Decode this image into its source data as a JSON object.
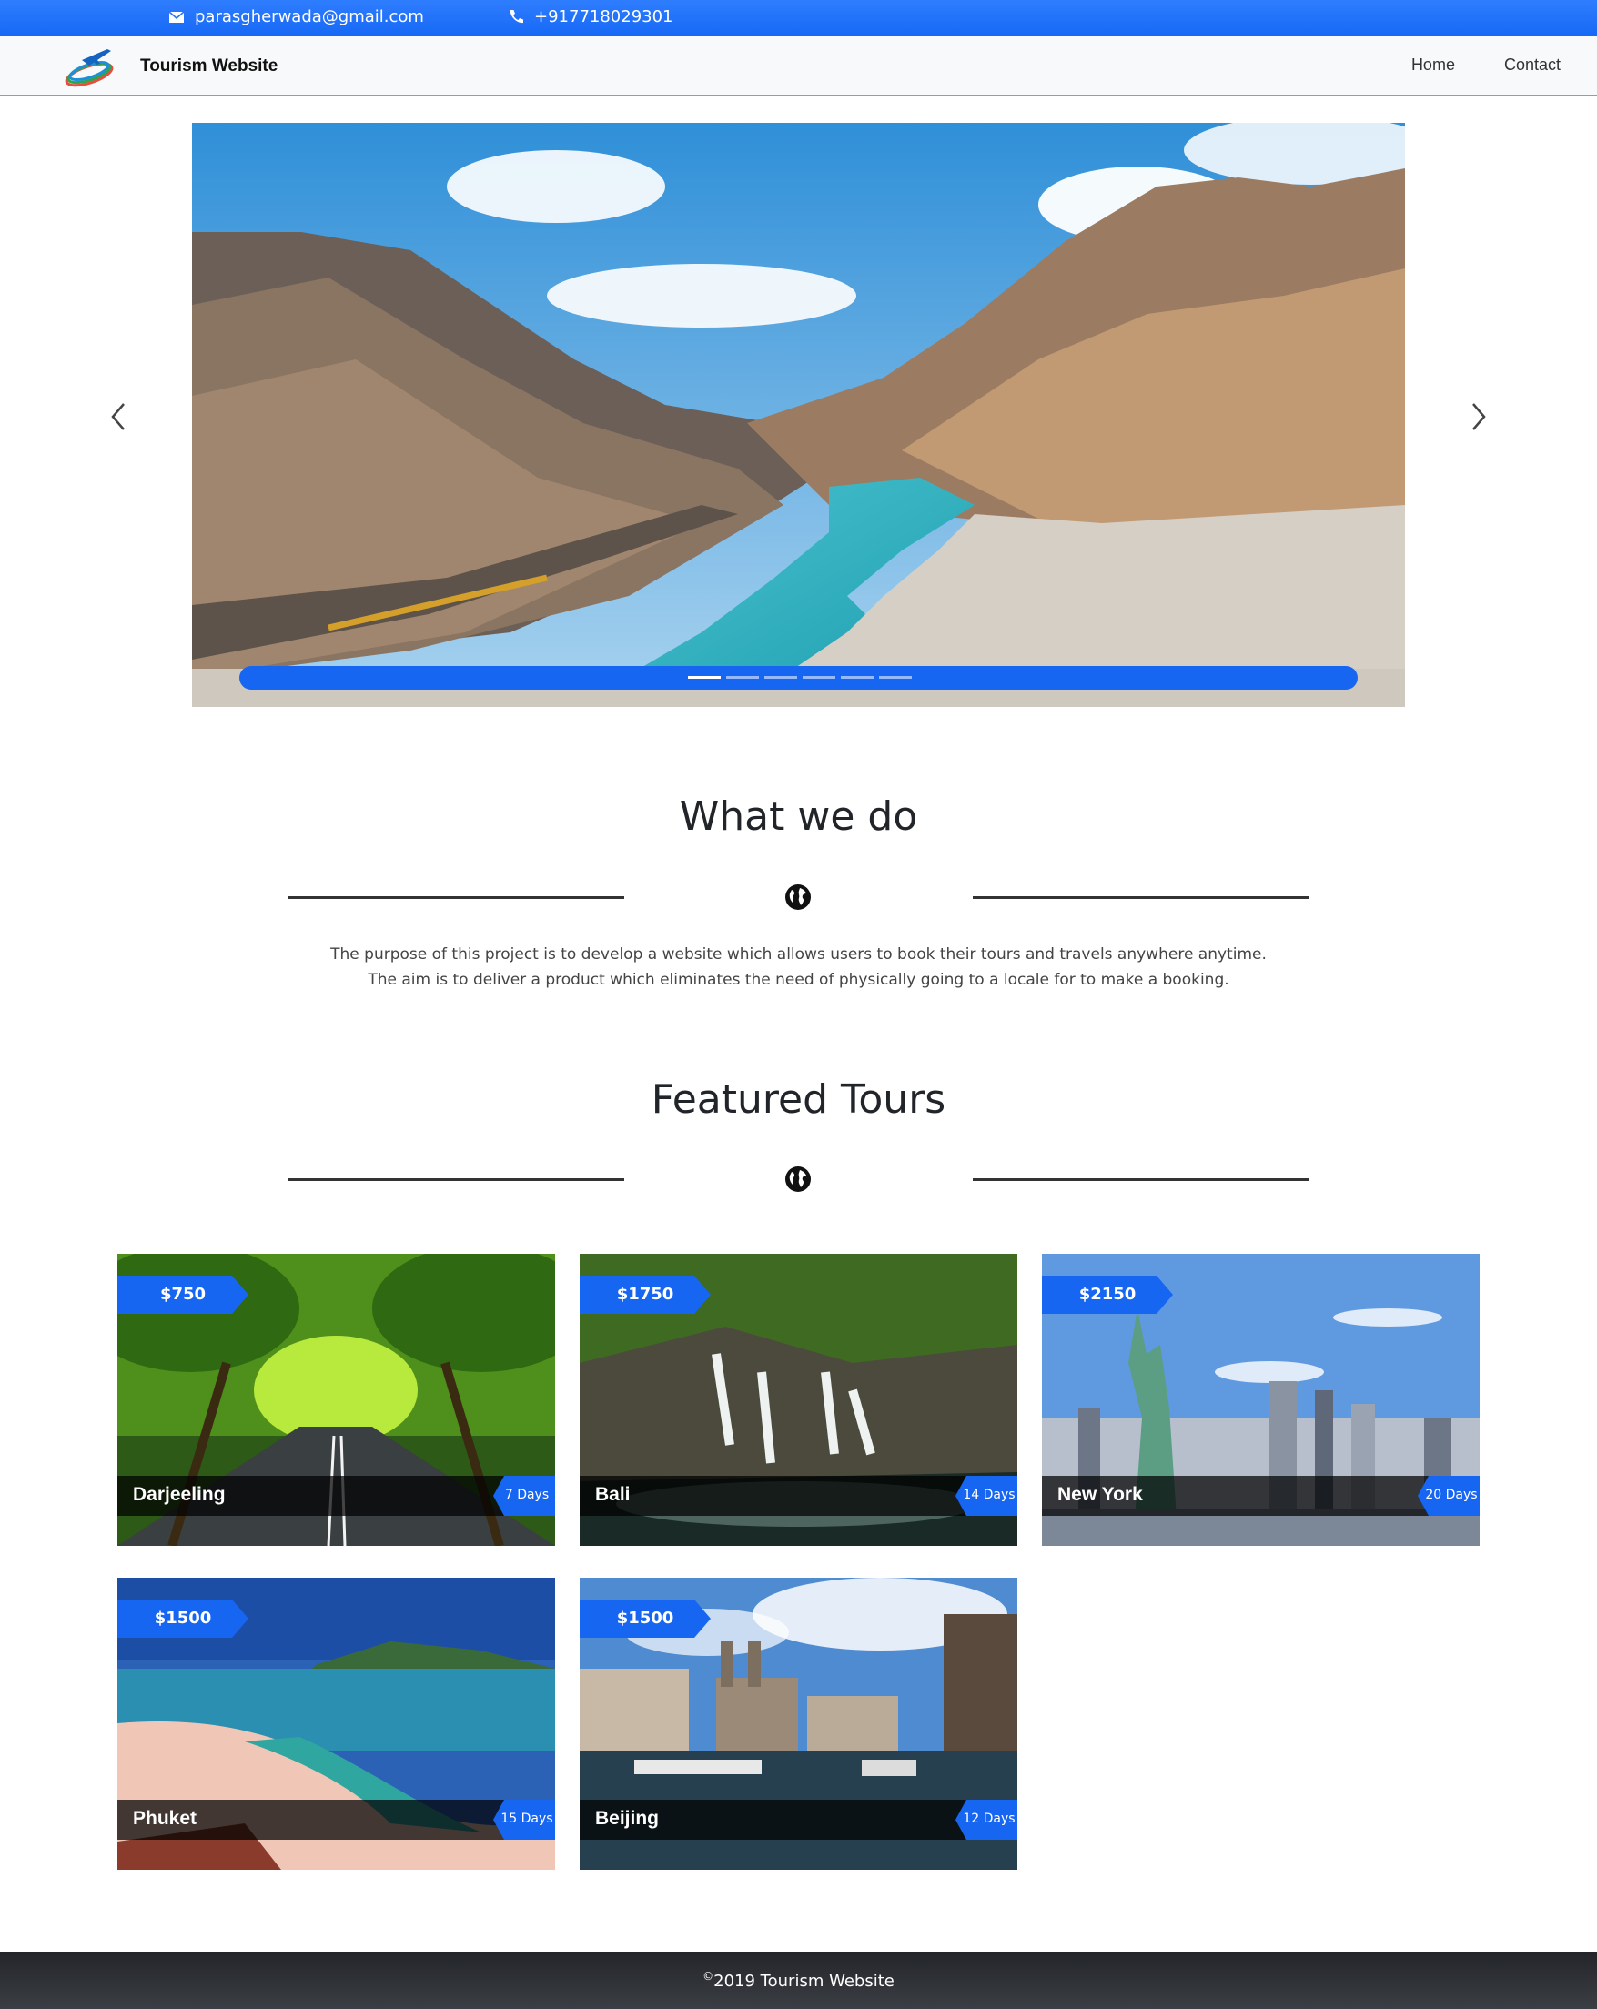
{
  "topbar": {
    "email": "parasgherwada@gmail.com",
    "phone": "+917718029301",
    "email_icon": "envelope-icon",
    "phone_icon": "phone-icon"
  },
  "navbar": {
    "brand": "Tourism Website",
    "links": [
      {
        "label": "Home"
      },
      {
        "label": "Contact"
      }
    ]
  },
  "carousel": {
    "slide_count": 6,
    "active_index": 0
  },
  "what_we_do": {
    "title": "What we do",
    "icon": "globe-icon",
    "lines": [
      "The purpose of this project is to develop a website which allows users to book their tours and travels anywhere anytime.",
      "The aim is to deliver a product which eliminates the need of physically going to a locale for to make a booking."
    ]
  },
  "featured": {
    "title": "Featured Tours",
    "icon": "globe-icon",
    "tours": [
      {
        "name": "Darjeeling",
        "price": "$750",
        "days": "7 Days"
      },
      {
        "name": "Bali",
        "price": "$1750",
        "days": "14 Days"
      },
      {
        "name": "New York",
        "price": "$2150",
        "days": "20 Days"
      },
      {
        "name": "Phuket",
        "price": "$1500",
        "days": "15 Days"
      },
      {
        "name": "Beijing",
        "price": "$1500",
        "days": "12 Days"
      }
    ]
  },
  "footer": {
    "copyright_symbol": "©",
    "text": "2019 Tourism Website"
  },
  "colors": {
    "accent": "#1766f2",
    "footer": "#2b2d31"
  }
}
